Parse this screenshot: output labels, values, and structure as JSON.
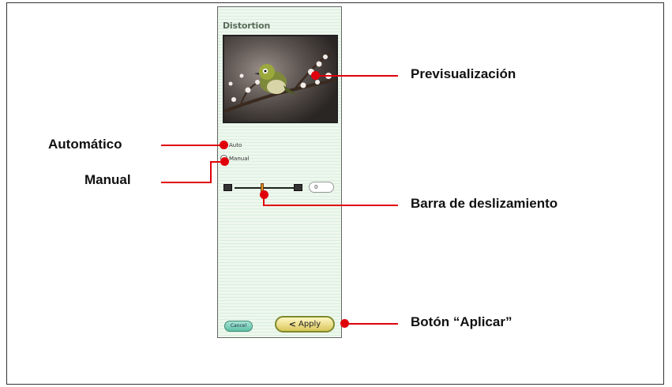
{
  "panel": {
    "title": "Distortion",
    "auto_label": "Auto",
    "manual_label": "Manual",
    "selected_mode": "Auto",
    "slider_value": "0",
    "cancel_label": "Cancel",
    "apply_label": "Apply",
    "apply_icon": "chevron-left-icon"
  },
  "annotations": {
    "preview": "Previsualización",
    "auto": "Automático",
    "manual": "Manual",
    "slider": "Barra de deslizamiento",
    "apply": "Botón “Aplicar”"
  },
  "colors": {
    "callout_red": "#e0000b",
    "panel_stripe": "#d9efdc",
    "apply_button": "#d9c65a",
    "cancel_button": "#5fbfa6"
  }
}
